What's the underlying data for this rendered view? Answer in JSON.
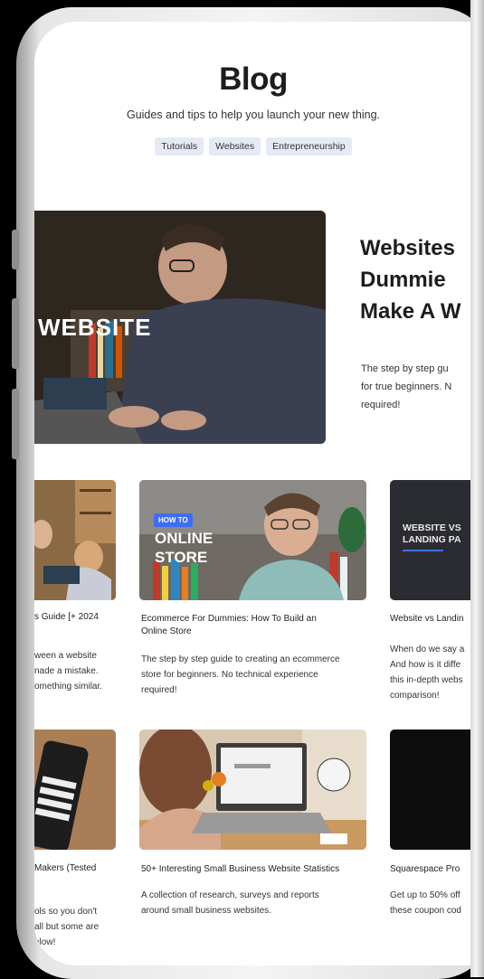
{
  "blog": {
    "title": "Blog",
    "subtitle": "Guides and tips to help you launch your new thing.",
    "tags": [
      "Tutorials",
      "Websites",
      "Entrepreneurship"
    ]
  },
  "hero": {
    "image_text": "WEBSITE",
    "title_lines": [
      "Websites",
      "Dummie",
      "Make A W"
    ],
    "description": "The step by step guide for true beginners. No required!",
    "desc_lines": [
      "The step by step gu",
      "for true beginners. N",
      "required!"
    ]
  },
  "cards_row1": [
    {
      "title_lines": [
        "s Guide [+ 2024"
      ],
      "desc_lines": [
        "ween a website",
        "nade a mistake.",
        "omething similar."
      ]
    },
    {
      "image_label": "HOW TO",
      "image_text": [
        "ONLINE",
        "STORE"
      ],
      "title_lines": [
        "Ecommerce For Dummies: How To Build an",
        "Online Store"
      ],
      "desc_lines": [
        "The step by step guide to creating an ecommerce",
        "store for beginners. No technical experience",
        "required!"
      ]
    },
    {
      "image_text": [
        "WEBSITE VS",
        "LANDING PA"
      ],
      "title_lines": [
        "Website vs Landin"
      ],
      "desc_lines": [
        "When do we say a",
        "And how is it diffe",
        "this in-depth webs",
        "comparison!"
      ]
    }
  ],
  "cards_row2": [
    {
      "title_lines": [
        "Makers (Tested"
      ],
      "desc_lines": [
        "ols so you don't",
        "all but some are",
        "elow!"
      ]
    },
    {
      "title_lines": [
        "50+ Interesting Small Business Website Statistics"
      ],
      "desc_lines": [
        "A collection of research, surveys and reports",
        "around small business websites."
      ]
    },
    {
      "title_lines": [
        "Squarespace Pro"
      ],
      "desc_lines": [
        "Get up to 50% off",
        "these coupon cod"
      ]
    }
  ]
}
